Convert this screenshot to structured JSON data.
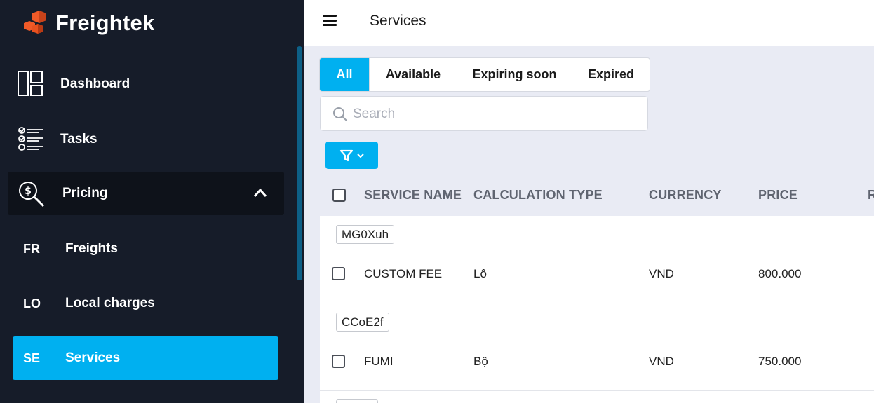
{
  "brand": {
    "name": "Freightek"
  },
  "header": {
    "title": "Services"
  },
  "sidebar": {
    "items": [
      {
        "label": "Dashboard",
        "icon": "dashboard-icon"
      },
      {
        "label": "Tasks",
        "icon": "tasks-icon"
      },
      {
        "label": "Pricing",
        "icon": "pricing-search-icon",
        "expanded": true
      },
      {
        "abbr": "FR",
        "label": "Freights"
      },
      {
        "abbr": "LO",
        "label": "Local charges"
      },
      {
        "abbr": "SE",
        "label": "Services",
        "active": true
      }
    ]
  },
  "tabs": [
    "All",
    "Available",
    "Expiring soon",
    "Expired"
  ],
  "search": {
    "placeholder": "Search"
  },
  "table": {
    "columns": [
      "SERVICE NAME",
      "CALCULATION TYPE",
      "CURRENCY",
      "PRICE",
      "R"
    ],
    "rows": [
      {
        "code": "MG0Xuh",
        "name": "CUSTOM FEE",
        "calc_type": "Lô",
        "currency": "VND",
        "price": "800.000"
      },
      {
        "code": "CCoE2f",
        "name": "FUMI",
        "calc_type": "Bộ",
        "currency": "VND",
        "price": "750.000"
      }
    ]
  },
  "colors": {
    "accent": "#00b0f0",
    "sidebar_bg": "#161c29",
    "brand_orange": "#f05a28"
  }
}
